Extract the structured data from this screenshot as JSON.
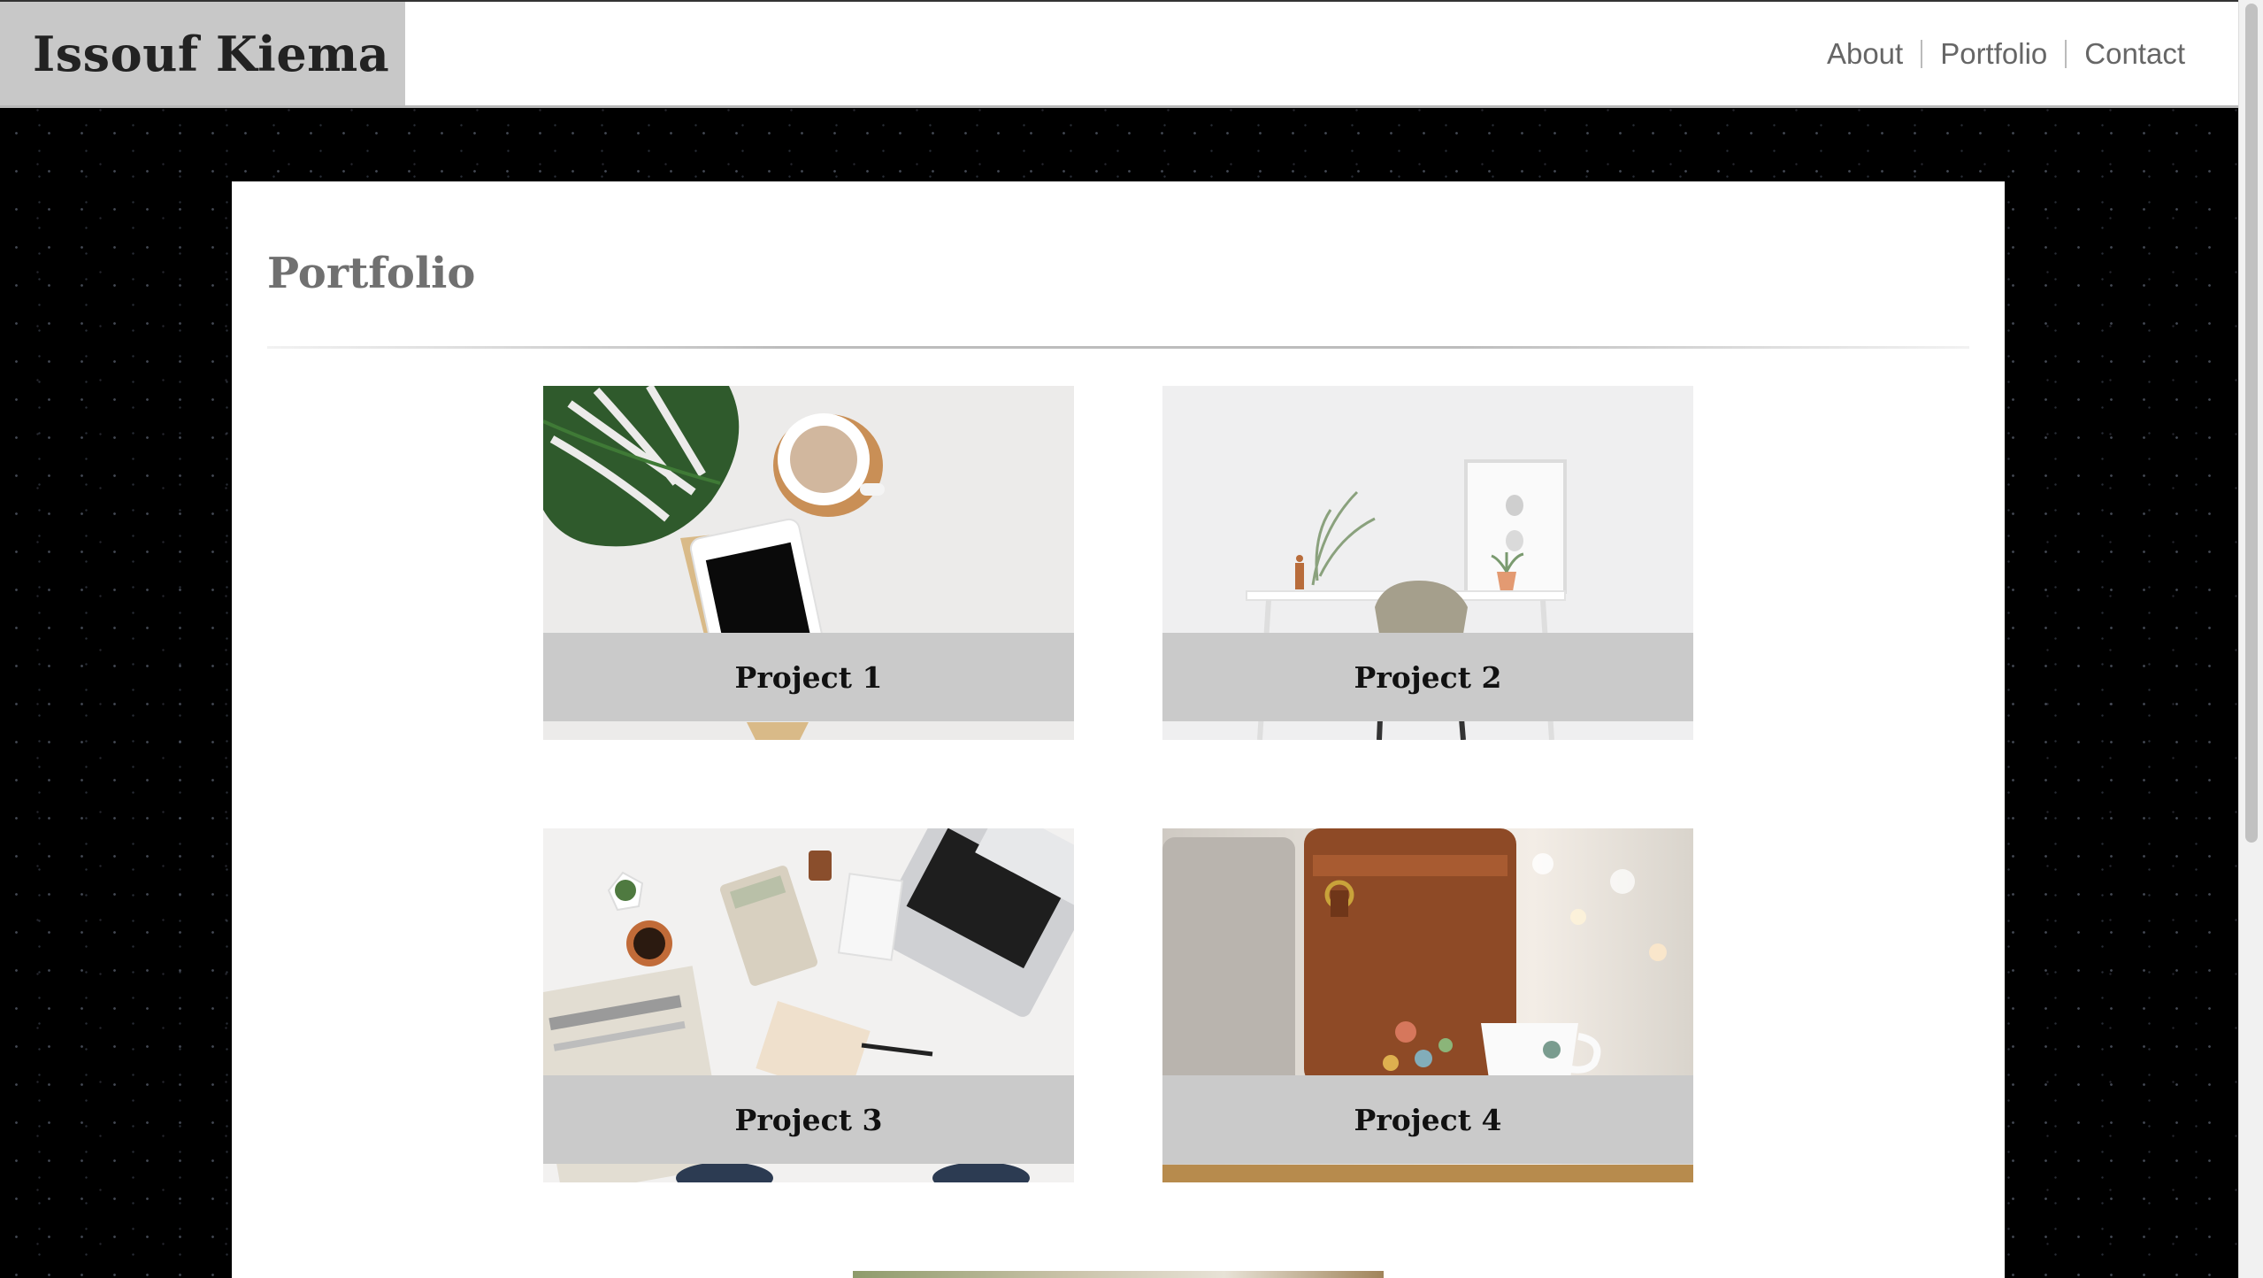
{
  "header": {
    "brand": "Issouf Kiema",
    "nav": [
      {
        "label": "About"
      },
      {
        "label": "Portfolio"
      },
      {
        "label": "Contact"
      }
    ]
  },
  "main": {
    "title": "Portfolio",
    "projects": [
      {
        "label": "Project 1",
        "image": "monstera leaf, coffee cup and tablet on white desk"
      },
      {
        "label": "Project 2",
        "image": "minimal white desk with chair, plants and picture frame"
      },
      {
        "label": "Project 3",
        "image": "laptop, calculator, coffee and newspaper on desk"
      },
      {
        "label": "Project 4",
        "image": "leather bag, laptop and coffee cup with bokeh lights"
      },
      {
        "label": "",
        "image": "partially visible fifth project image"
      }
    ]
  },
  "colors": {
    "brand_bg": "#c8c8c8",
    "caption_bg": "#cacaca",
    "page_bg": "#000000",
    "panel_bg": "#ffffff",
    "nav_text": "#666666",
    "title_text": "#707070"
  }
}
